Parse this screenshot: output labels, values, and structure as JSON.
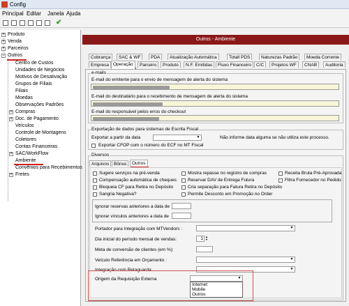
{
  "window": {
    "title": "Config"
  },
  "menu": [
    "Principal",
    "Editar",
    "Janela",
    "Ajuda"
  ],
  "tree": {
    "nodes": [
      "Produto",
      "Venda",
      "Parceiros",
      "Outros",
      "Centro de Custos",
      "Unidades de Negócios",
      "Motivos de Desativação",
      "Grupos de Filiais",
      "Filiais",
      "Moedas",
      "Observações Padrões",
      "Compras",
      "Doc. de Pagamento",
      "Veículos",
      "Controle de Montagens",
      "Coletores",
      "Contas Financeiras",
      "SAC/WorkFlow",
      "Ambiente",
      "Convênios para Recebimentos c",
      "Fretes"
    ]
  },
  "panel": {
    "header": "Outros - Ambiente",
    "tabs_row1": [
      "Cobrança",
      "SAC & WF",
      "PDA",
      "Atualização Automática",
      "Totall PDS",
      "Naturezas Padrão",
      "Moeda Corrente"
    ],
    "tabs_row2": [
      "Empresa",
      "Operação",
      "Parceiro",
      "Produto",
      "N.F. Emitidas",
      "Fluxo Financeiro",
      "C/C",
      "Projetos WF",
      "CNAB",
      "Auditoria"
    ]
  },
  "email": {
    "group_title": "e-mails",
    "sender_label": "E-mail do emitente para o envio de mensagem de alerta do sistema",
    "recipient_label": "E-mail do destinatário para o recebimento de mensagem de alerta do sistema",
    "checkout_label": "E-mail do responsável pelos erros do checkout"
  },
  "export": {
    "group_title": "Exportação de dados para sistemas de Escrita Fiscal",
    "from_label": "Exportar a partir da data",
    "note": "Não informe data alguma se não utiliza este processo.",
    "cfop_label": "Exportar CFOP com o número do ECF no MT Fiscal"
  },
  "diversos": {
    "group_title": "Diversos",
    "subtabs": [
      "Arquivos",
      "Bônus",
      "Outros"
    ],
    "checkboxes": [
      "Sugere serviços na pré-venda",
      "Mostra repasse no registro de compras",
      "Receita Bruta Pré-Aprovada",
      "Compensação automática de cheques",
      "Reservar DAV de Entrega Futura",
      "Filtra Fornecedor no Pedido",
      "Bloqueia CF para Retira no Depósito",
      "Cria separação para Fatura Retira no Depósito",
      "Sangria Negativa?",
      "Permite Desconto em Promoção no Order"
    ],
    "reservas_label": "Ignorar reservas anteriores a data de",
    "vinculos_label": "Ignorar vínculos anteriores a data de",
    "portador_label": "Portador para Integração com MTVendors :",
    "dia_label": "Dia inicial do período mensal de vendas:",
    "dia_value": "1",
    "meta_label": "Meta de conversão de clientes (em %):",
    "veiculo_label": "Veículo Referência em Orçamento :",
    "retaguarda_label": "Integração com Retaguarda:",
    "origem_label": "Origem da Requisição Externa",
    "origem_options": [
      "Internet",
      "Mobile",
      "Outros"
    ]
  },
  "colors": {
    "header_bg": "#8a1818",
    "highlight": "#d02020"
  }
}
